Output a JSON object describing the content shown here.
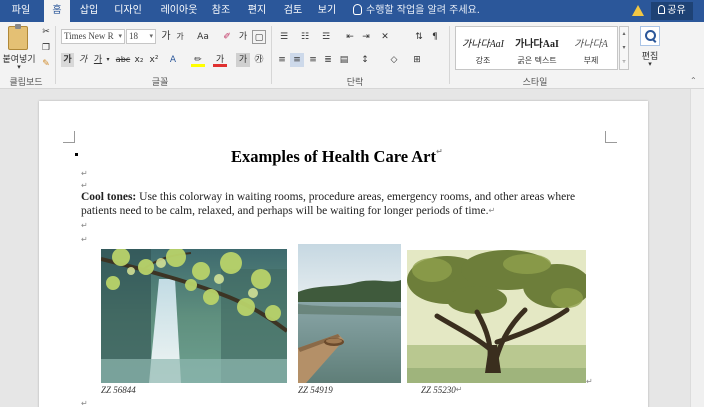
{
  "tabs": [
    {
      "label": "파일",
      "active": false
    },
    {
      "label": "홈",
      "active": true
    },
    {
      "label": "삽입",
      "active": false
    },
    {
      "label": "디자인",
      "active": false
    },
    {
      "label": "레이아웃",
      "active": false
    },
    {
      "label": "참조",
      "active": false
    },
    {
      "label": "편지",
      "active": false
    },
    {
      "label": "검토",
      "active": false
    },
    {
      "label": "보기",
      "active": false
    }
  ],
  "tellme": "수행할 작업을 알려 주세요.",
  "share_label": "공유",
  "ribbon": {
    "clipboard": {
      "paste_label": "붙여넣기",
      "group_label": "클립보드"
    },
    "font": {
      "font_name": "Times New R",
      "font_size": "18",
      "grow": "가",
      "shrink": "가",
      "case": "Aa",
      "bold": "가",
      "italic": "가",
      "underline": "가",
      "strike": "abc",
      "subscript": "x₂",
      "superscript": "x²",
      "font_color_glyph": "가",
      "char_shade": "가",
      "phonetic": "가",
      "enclose": "㉮",
      "group_label": "글꼴"
    },
    "paragraph": {
      "group_label": "단락"
    },
    "styles": {
      "items": [
        {
          "sample": "가나다AaI",
          "name": "강조"
        },
        {
          "sample": "가나다AaI",
          "name": "굵은 텍스트"
        },
        {
          "sample": "가나다A",
          "name": "부제"
        }
      ],
      "group_label": "스타일"
    },
    "editing": {
      "label": "편집"
    }
  },
  "document": {
    "title": "Examples of Health Care Art",
    "para_bold": "Cool tones:",
    "para_text": "  Use this colorway in waiting rooms, procedure areas, emergency rooms, and other areas where patients need to be calm, relaxed, and perhaps will be waiting for longer periods of time.",
    "paragraph_mark": "↵",
    "captions": [
      "ZZ 56844",
      "ZZ 54919",
      "ZZ 55230"
    ]
  },
  "colors": {
    "ribbon_blue": "#2b579a",
    "highlight_yellow": "#ffff00",
    "font_red": "#e03030"
  }
}
